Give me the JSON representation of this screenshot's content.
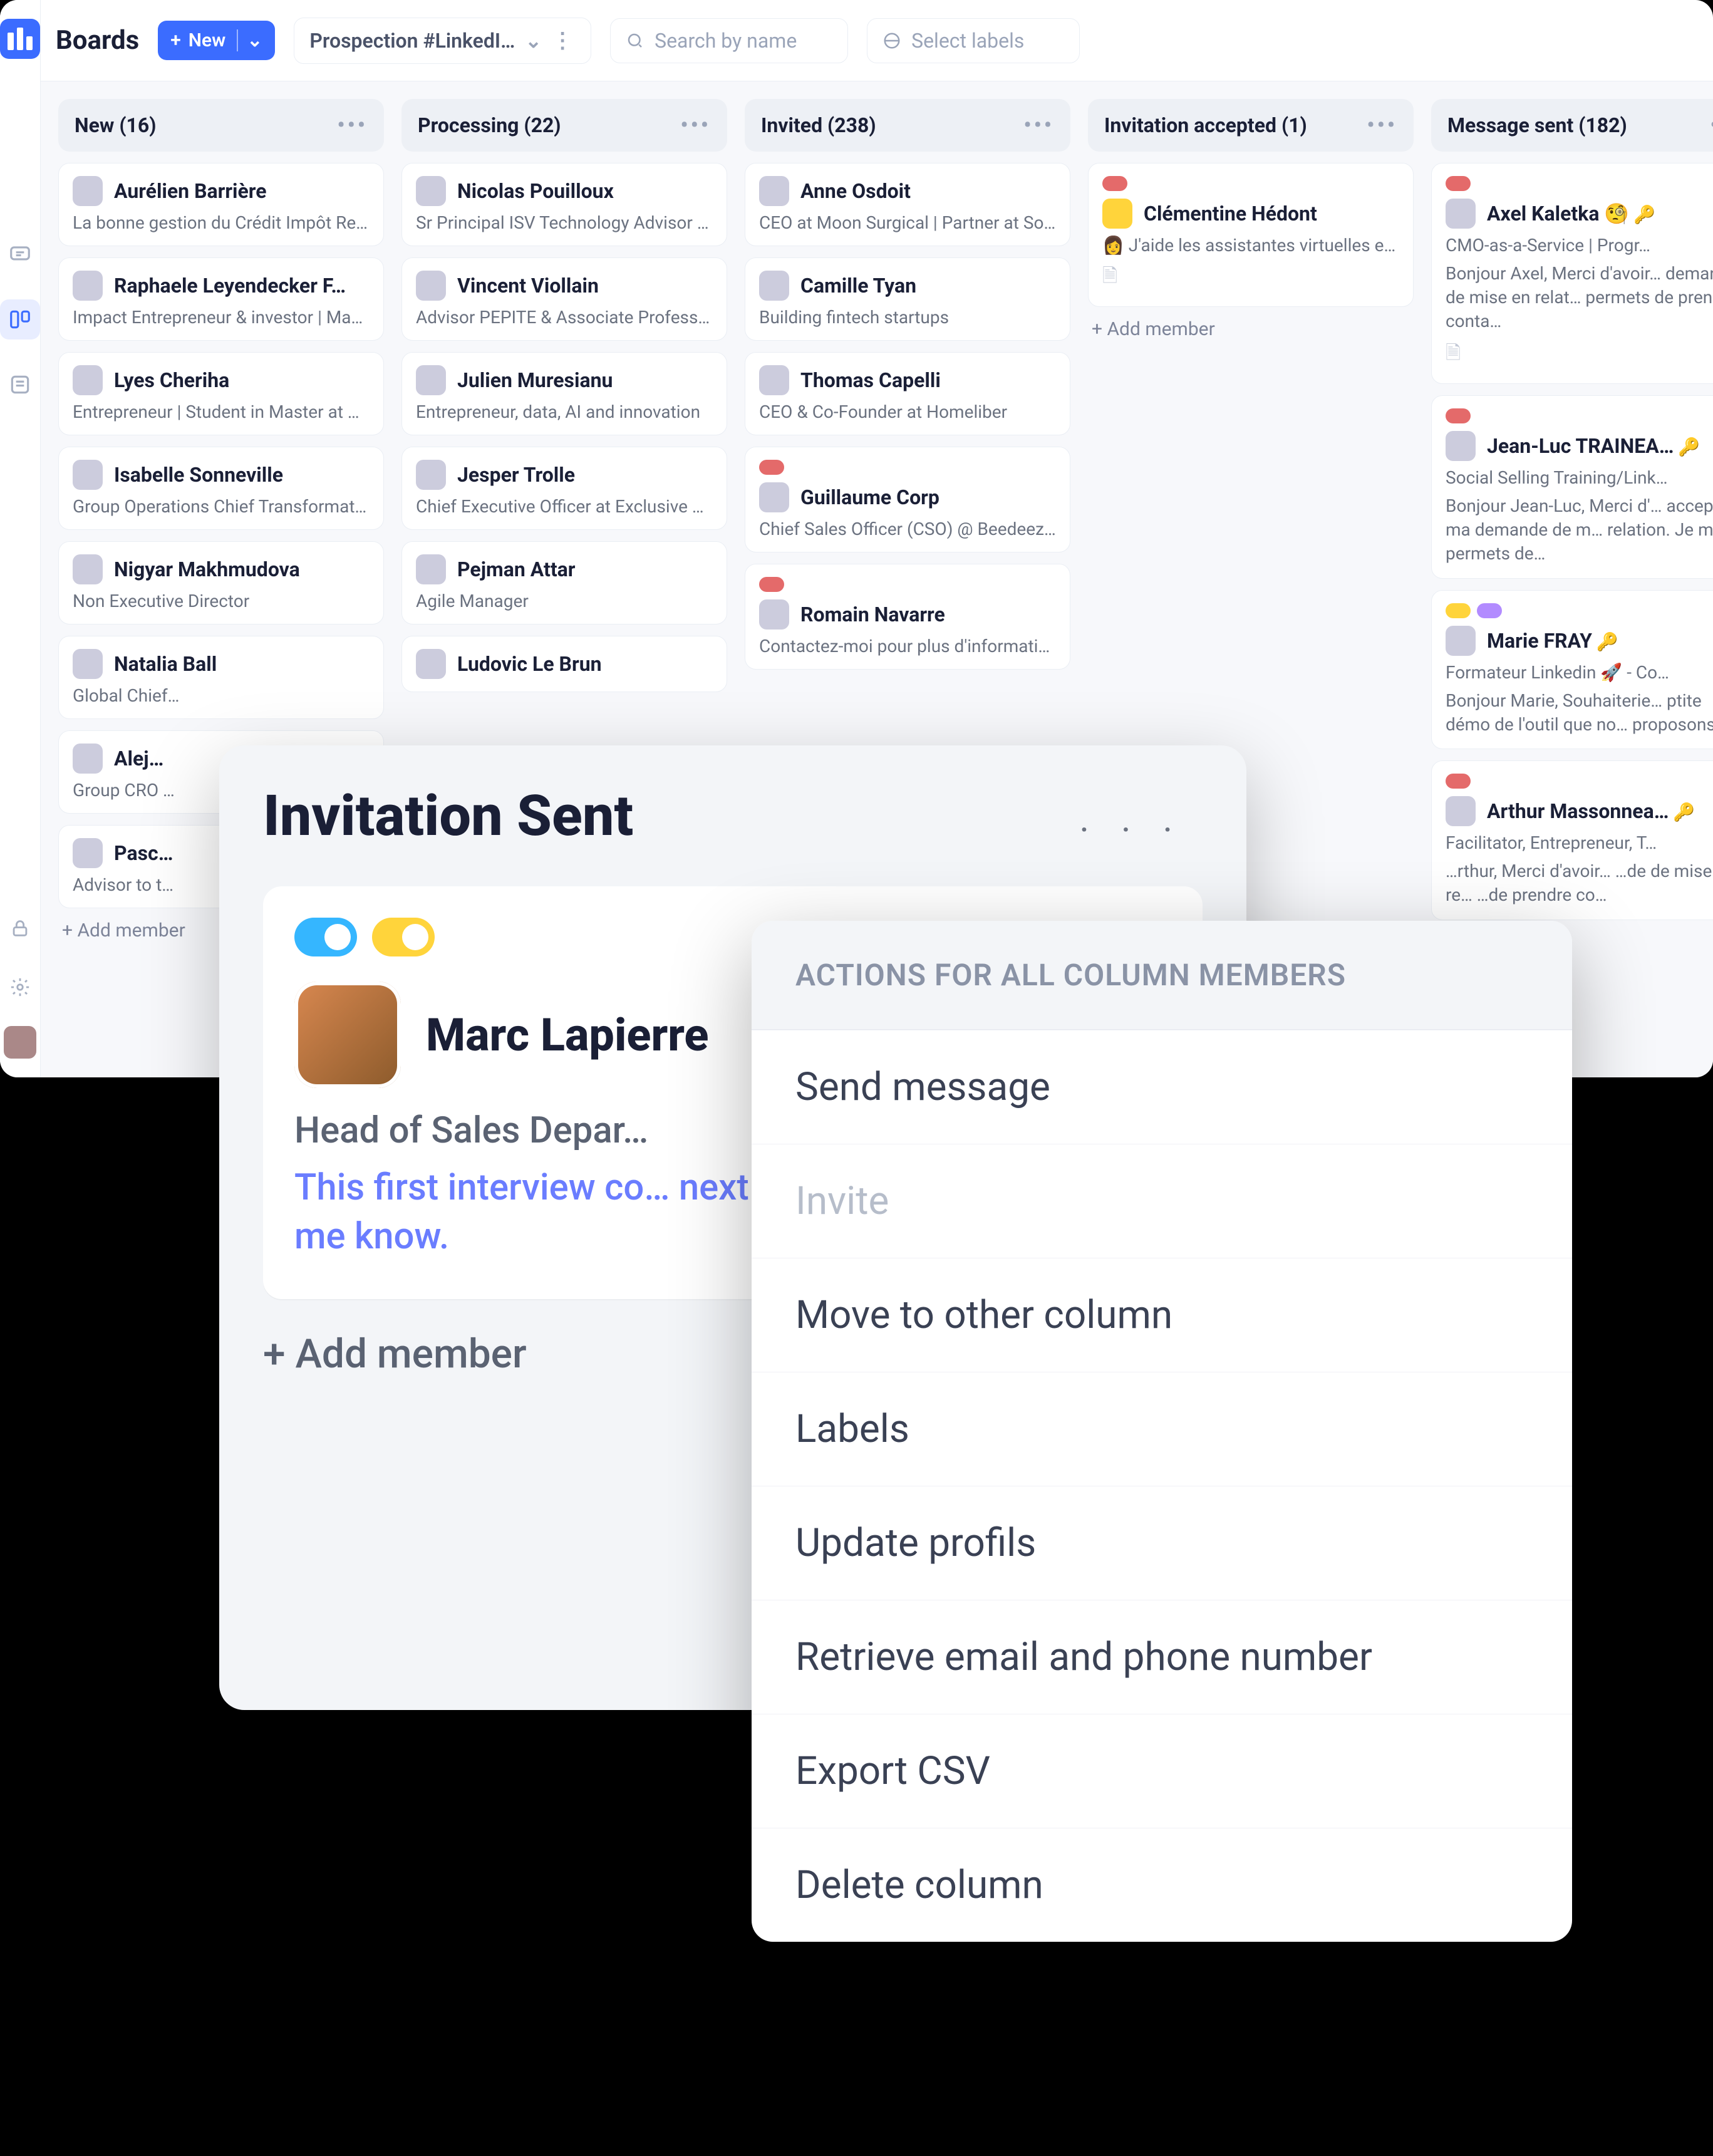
{
  "topbar": {
    "boards_label": "Boards",
    "new_label": "New",
    "board_name": "Prospection #LinkedI…",
    "search_placeholder": "Search by name",
    "labels_placeholder": "Select labels"
  },
  "columns": [
    {
      "title": "New (16)",
      "add_label": "+ Add member",
      "cards": [
        {
          "name": "Aurélien Barrière",
          "sub": "La bonne gestion du Crédit Impôt Rec…"
        },
        {
          "name": "Raphaele Leyendecker F…",
          "sub": "Impact Entrepreneur & investor | Man…"
        },
        {
          "name": "Lyes Cheriha",
          "sub": "Entrepreneur | Student in Master at S…"
        },
        {
          "name": "Isabelle Sonneville",
          "sub": "Group Operations Chief Transformati…"
        },
        {
          "name": "Nigyar Makhmudova",
          "sub": "Non Executive Director"
        },
        {
          "name": "Natalia Ball",
          "sub": "Global Chief…"
        },
        {
          "name": "Alej…",
          "sub": "Group CRO …"
        },
        {
          "name": "Pasc…",
          "sub": "Advisor to t…"
        }
      ]
    },
    {
      "title": "Processing (22)",
      "cards": [
        {
          "name": "Nicolas Pouilloux",
          "sub": "Sr Principal ISV Technology Advisor A…"
        },
        {
          "name": "Vincent Viollain",
          "sub": "Advisor PEPITE & Associate Professo…"
        },
        {
          "name": "Julien Muresianu",
          "sub": "Entrepreneur, data, AI and innovation"
        },
        {
          "name": "Jesper Trolle",
          "sub": "Chief Executive Officer at Exclusive N…"
        },
        {
          "name": "Pejman Attar",
          "sub": "Agile Manager"
        },
        {
          "name": "Ludovic Le Brun",
          "sub": ""
        }
      ]
    },
    {
      "title": "Invited (238)",
      "cards": [
        {
          "name": "Anne Osdoit",
          "sub": "CEO at Moon Surgical | Partner at So…"
        },
        {
          "name": "Camille Tyan",
          "sub": "Building fintech startups"
        },
        {
          "name": "Thomas Capelli",
          "sub": "CEO & Co-Founder at Homeliber"
        },
        {
          "name": "Guillaume Corp",
          "sub": "Chief Sales Officer (CSO) @ Beedeez …",
          "tags": [
            "red"
          ]
        },
        {
          "name": "Romain Navarre",
          "sub": "Contactez-moi pour plus d'informatio…",
          "tags": [
            "red"
          ]
        }
      ]
    },
    {
      "title": "Invitation accepted (1)",
      "add_label": "+ Add member",
      "cards": [
        {
          "name": "Clémentine Hédont",
          "sub": "👩 J'aide les assistantes virtuelles et l…",
          "tags": [
            "red"
          ],
          "doc": true,
          "avatar": "y"
        }
      ]
    },
    {
      "title": "Message sent (182)",
      "cards": [
        {
          "name": "Axel Kaletka 🧐",
          "sub": "CMO-as-a-Service | Progr…",
          "body": "Bonjour Axel, Merci d'avoir… demande de mise en relat… permets de prendre conta…",
          "tags": [
            "red"
          ],
          "doc": true
        },
        {
          "name": "Jean-Luc TRAINEA…",
          "sub": "Social Selling Training/Link…",
          "body": "Bonjour Jean-Luc, Merci d'… accepté ma demande de m… relation. Je me permets de…",
          "tags": [
            "red"
          ]
        },
        {
          "name": "Marie FRAY",
          "sub": "Formateur Linkedin 🚀 - Co…",
          "body": "Bonjour Marie, Souhaiterie… ptite démo de l'outil que no… proposons ?",
          "tags": [
            "yel",
            "pur"
          ]
        },
        {
          "name": "Arthur Massonnea…",
          "sub": "Facilitator, Entrepreneur, T…",
          "body": "…rthur, Merci d'avoir… …de de mise en re… …de prendre co…",
          "tags": [
            "red"
          ]
        }
      ]
    }
  ],
  "detail": {
    "title": "Invitation Sent",
    "person_name": "Marc Lapierre",
    "role": "Head of Sales Depar…",
    "note": "This first interview co… next Wednesday at … PM. Let me know.",
    "add_label": "+ Add member"
  },
  "menu": {
    "header": "ACTIONS FOR ALL COLUMN MEMBERS",
    "items": [
      {
        "label": "Send message"
      },
      {
        "label": "Invite",
        "disabled": true
      },
      {
        "label": "Move to other column"
      },
      {
        "label": "Labels"
      },
      {
        "label": "Update profils"
      },
      {
        "label": "Retrieve email and phone number"
      },
      {
        "label": "Export CSV"
      },
      {
        "label": "Delete column"
      }
    ]
  }
}
